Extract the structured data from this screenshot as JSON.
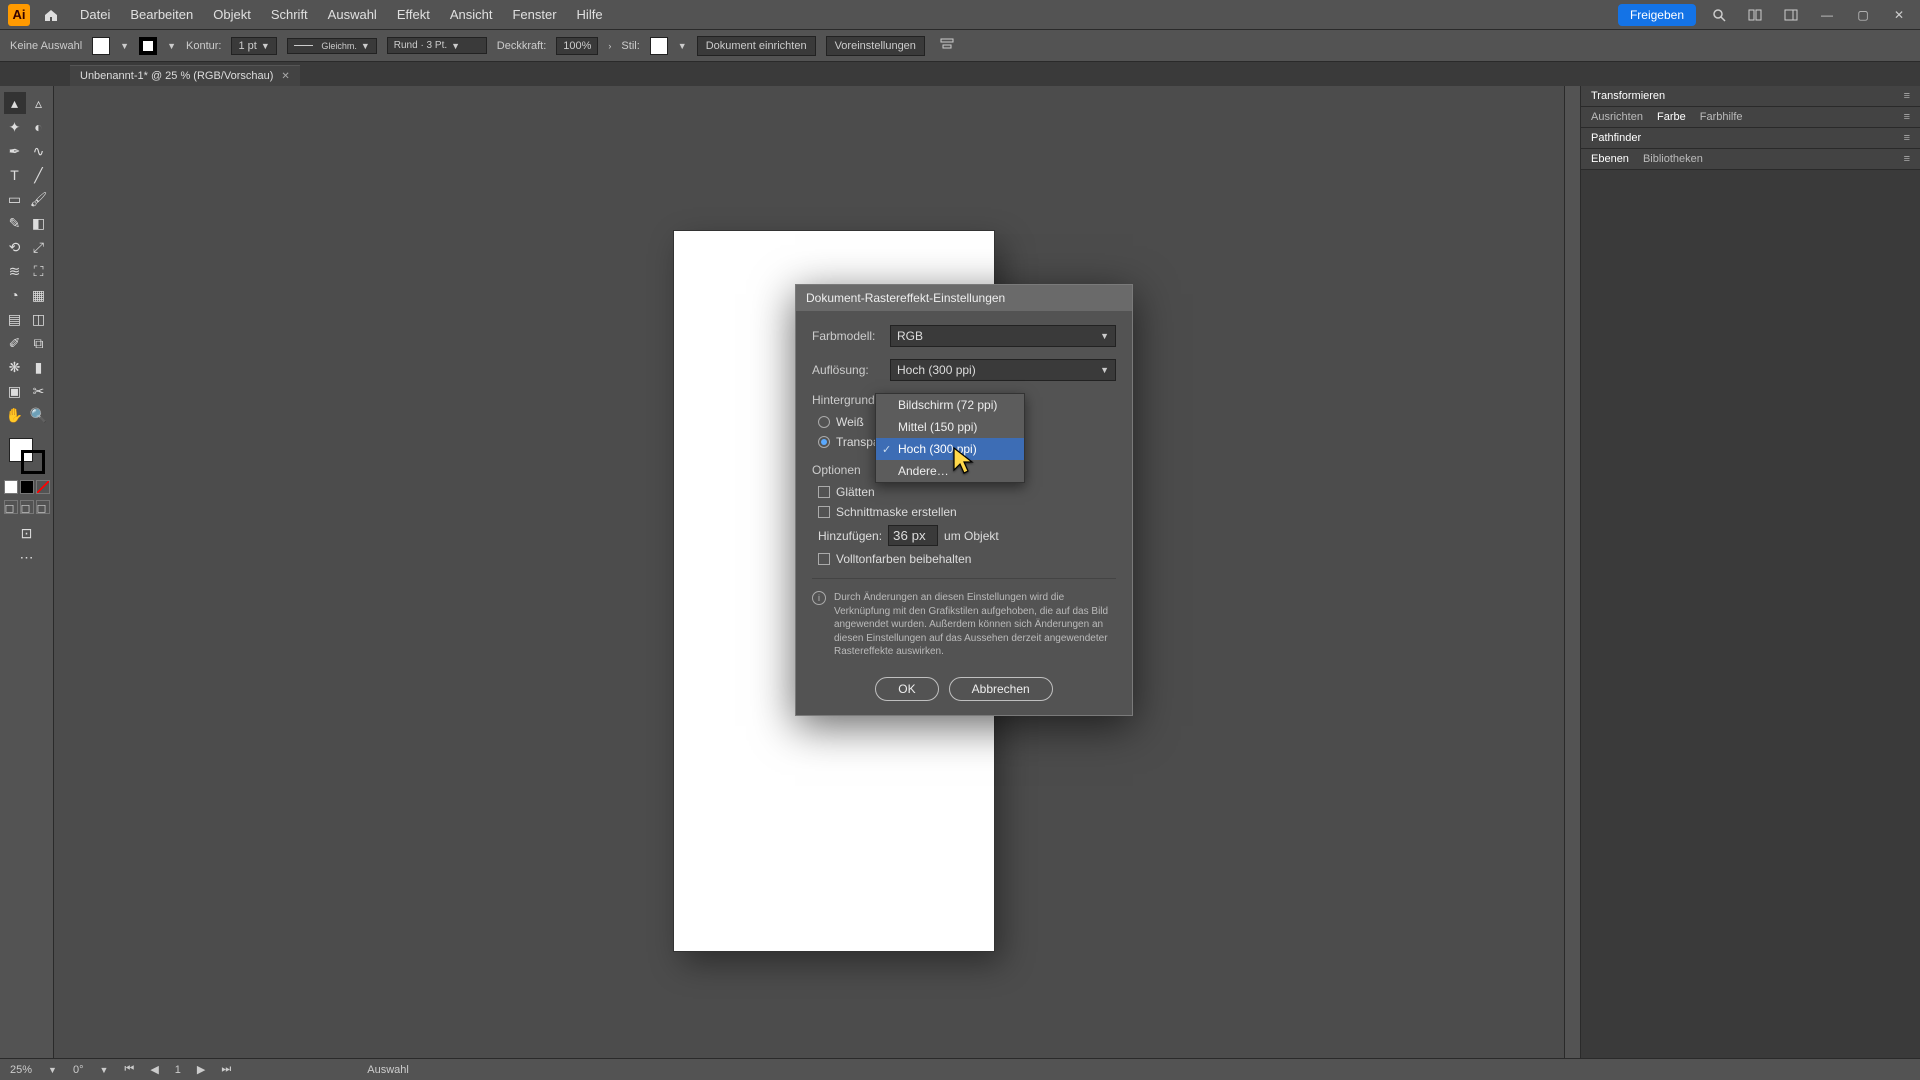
{
  "menu": {
    "items": [
      "Datei",
      "Bearbeiten",
      "Objekt",
      "Schrift",
      "Auswahl",
      "Effekt",
      "Ansicht",
      "Fenster",
      "Hilfe"
    ],
    "share": "Freigeben"
  },
  "control": {
    "no_selection": "Keine Auswahl",
    "kontur": "Kontur:",
    "stroke_w": "1 pt",
    "profile": "Gleichm.",
    "brush": "Rund · 3 Pt.",
    "opacity_label": "Deckkraft:",
    "opacity": "100%",
    "style": "Stil:",
    "doc_setup": "Dokument einrichten",
    "prefs": "Voreinstellungen"
  },
  "tab": {
    "name": "Unbenannt-1* @ 25 % (RGB/Vorschau)"
  },
  "panels": {
    "transform": "Transformieren",
    "align": "Ausrichten",
    "color": "Farbe",
    "colorguide": "Farbhilfe",
    "pathfinder": "Pathfinder",
    "layers": "Ebenen",
    "libs": "Bibliotheken"
  },
  "status": {
    "zoom": "25%",
    "rot": "0°",
    "art": "1",
    "mode": "Auswahl"
  },
  "dialog": {
    "title": "Dokument-Rastereffekt-Einstellungen",
    "colormodel_label": "Farbmodell:",
    "colormodel": "RGB",
    "res_label": "Auflösung:",
    "res": "Hoch (300 ppi)",
    "bg_label": "Hintergrund",
    "bg_white": "Weiß",
    "bg_trans": "Transparent",
    "opts_label": "Optionen",
    "opt_smooth": "Glätten",
    "opt_clip": "Schnittmaske erstellen",
    "add_label": "Hinzufügen:",
    "add_val": "36 px",
    "add_suffix": "um Objekt",
    "opt_spot": "Volltonfarben beibehalten",
    "info": "Durch Änderungen an diesen Einstellungen wird die Verknüpfung mit den Grafikstilen aufgehoben, die auf das Bild angewendet wurden. Außerdem können sich Änderungen an diesen Einstellungen auf das Aussehen derzeit angewendeter Rastereffekte auswirken.",
    "ok": "OK",
    "cancel": "Abbrechen"
  },
  "dropdown": {
    "items": [
      "Bildschirm (72 ppi)",
      "Mittel (150 ppi)",
      "Hoch (300 ppi)",
      "Andere…"
    ],
    "selected": 2,
    "hover": 2
  }
}
